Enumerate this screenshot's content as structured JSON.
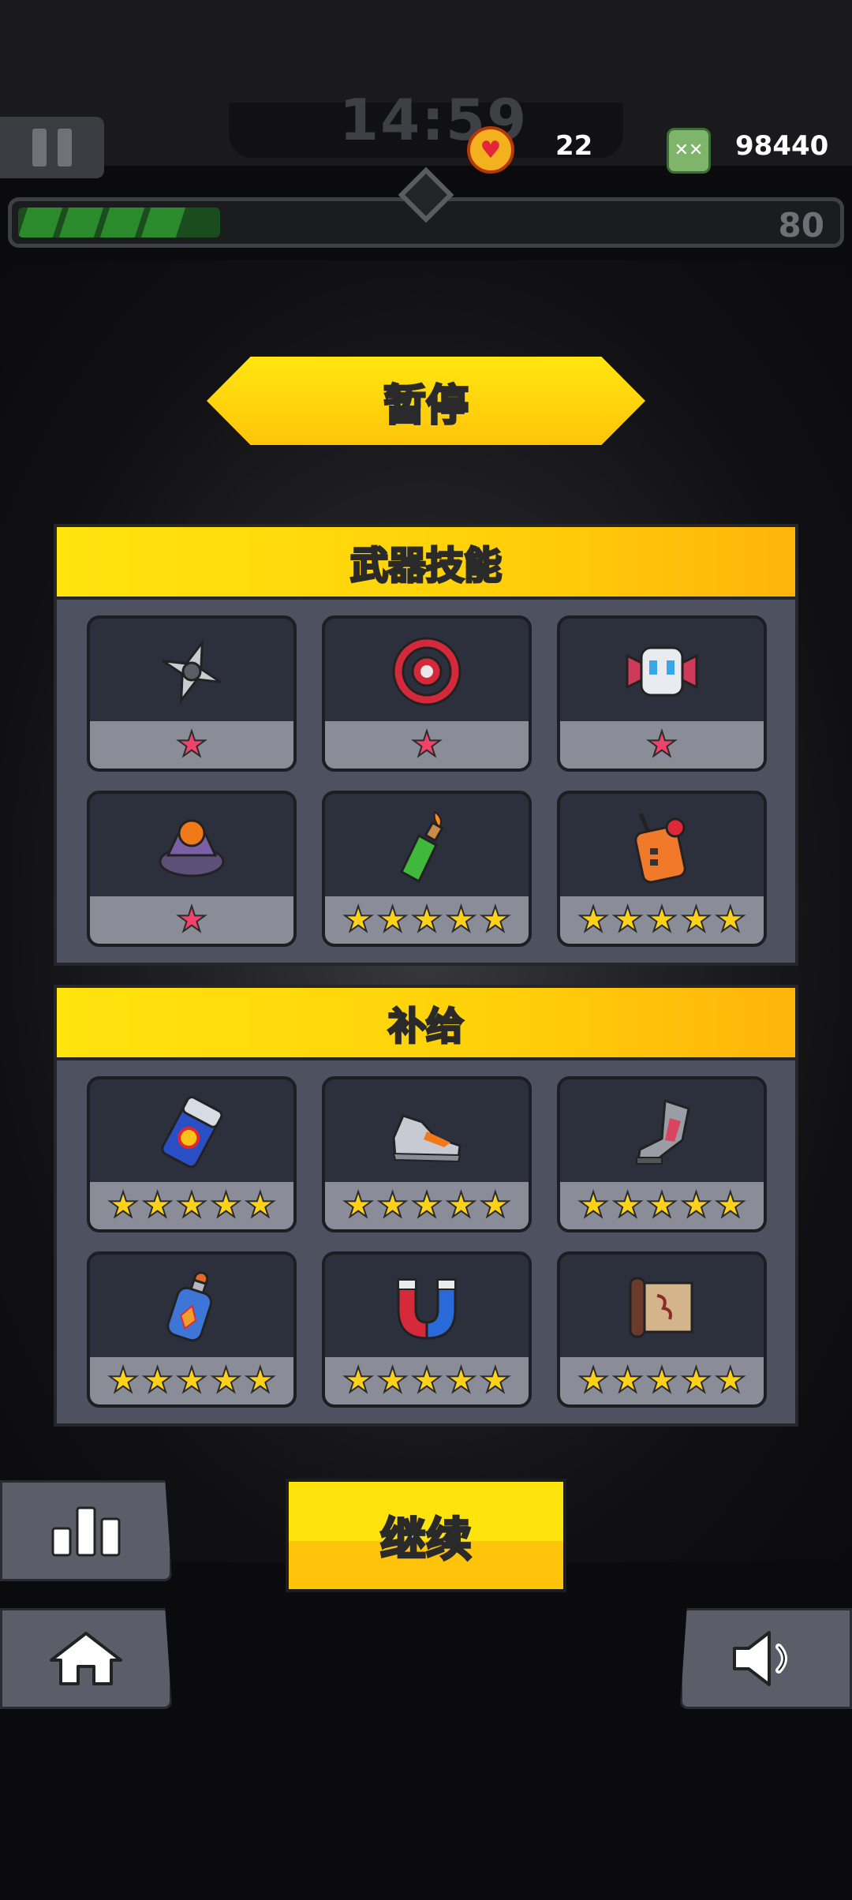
{
  "hud": {
    "timer": "14:59",
    "hp": "22",
    "coins": "98440",
    "level": "80",
    "xp_progress": 0.24,
    "coin_badge": "✕✕"
  },
  "title": "暂停",
  "weapons": {
    "heading": "武器技能",
    "items": [
      {
        "icon": "shuriken-icon",
        "stars": 1,
        "star_color": "pink"
      },
      {
        "icon": "target-disc-icon",
        "stars": 1,
        "star_color": "pink"
      },
      {
        "icon": "robot-drone-icon",
        "stars": 1,
        "star_color": "pink"
      },
      {
        "icon": "landmine-icon",
        "stars": 1,
        "star_color": "pink"
      },
      {
        "icon": "molotov-bottle-icon",
        "stars": 5,
        "star_color": "yellow"
      },
      {
        "icon": "remote-detonator-icon",
        "stars": 5,
        "star_color": "yellow"
      }
    ]
  },
  "supplies": {
    "heading": "补给",
    "items": [
      {
        "icon": "energy-drink-icon",
        "stars": 5,
        "star_color": "yellow"
      },
      {
        "icon": "sneaker-icon",
        "stars": 5,
        "star_color": "yellow"
      },
      {
        "icon": "armored-boot-icon",
        "stars": 5,
        "star_color": "yellow"
      },
      {
        "icon": "potion-bottle-icon",
        "stars": 5,
        "star_color": "yellow"
      },
      {
        "icon": "magnet-icon",
        "stars": 5,
        "star_color": "yellow"
      },
      {
        "icon": "scroll-icon",
        "stars": 5,
        "star_color": "yellow"
      }
    ]
  },
  "continue_label": "继续",
  "colors": {
    "accent_yellow": "#ffd00a",
    "panel": "#4d5160",
    "star_pink": "#f0436b",
    "star_yellow": "#ffd21a",
    "xp_green": "#2a8a2c"
  }
}
